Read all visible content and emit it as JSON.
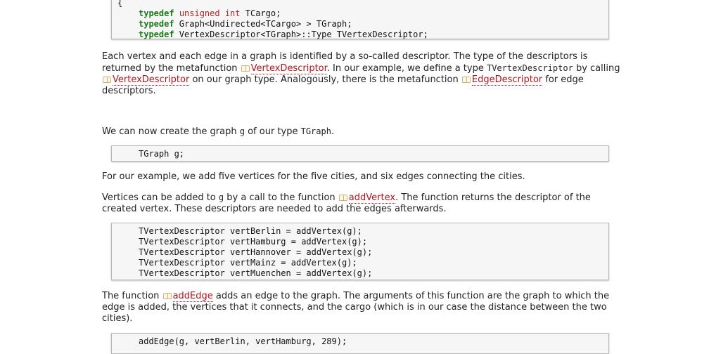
{
  "code_block_1": {
    "lines": [
      "{",
      "    typedef unsigned int TCargo;",
      "    typedef Graph<Undirected<TCargo> > TGraph;",
      "    typedef VertexDescriptor<TGraph>::Type TVertexDescriptor;"
    ]
  },
  "para_descriptor": {
    "t1": "Each vertex and each edge in a graph is identified by a so-called descriptor. The type of the descriptors is returned by the metafunction ",
    "link1": "VertexDescriptor",
    "t2": ". In our example, we define a type ",
    "code1": "TVertexDescriptor",
    "t3": " by calling ",
    "link2": "VertexDescriptor",
    "t4": " on our graph type. Analogously, there is the metafunction ",
    "link3": "EdgeDescriptor",
    "t5": " for edge descriptors."
  },
  "para_create": {
    "t1": "We can now create the graph ",
    "code1": "g",
    "t2": " of our type ",
    "code2": "TGraph",
    "t3": "."
  },
  "code_block_2": {
    "line": "TGraph g;"
  },
  "para_example": "For our example, we add five vertices for the five cities, and six edges connecting the cities.",
  "para_vertices": {
    "t1": "Vertices can be added to ",
    "code1": "g",
    "t2": " by a call to the function ",
    "link1": "addVertex",
    "t3": ". The function returns the descriptor of the created vertex. These descriptors are needed to add the edges afterwards."
  },
  "code_block_3": {
    "lines": [
      "TVertexDescriptor vertBerlin = addVertex(g);",
      "TVertexDescriptor vertHamburg = addVertex(g);",
      "TVertexDescriptor vertHannover = addVertex(g);",
      "TVertexDescriptor vertMainz = addVertex(g);",
      "TVertexDescriptor vertMuenchen = addVertex(g);"
    ]
  },
  "para_addedge": {
    "t1": "The function ",
    "link1": "addEdge",
    "t2": " adds an edge to the graph. The arguments of this function are the graph to which the edge is added, the vertices that it connects, and the cargo (which is in our case the distance between the two cities)."
  },
  "code_block_4": {
    "line": "addEdge(g, vertBerlin, vertHamburg, 289);"
  },
  "colors": {
    "link": "#b0151c",
    "keyword": "#1a7a1a",
    "type": "#b22222",
    "code_bg": "#f6f6f6"
  },
  "icons": {
    "doc_link": "book-icon"
  }
}
